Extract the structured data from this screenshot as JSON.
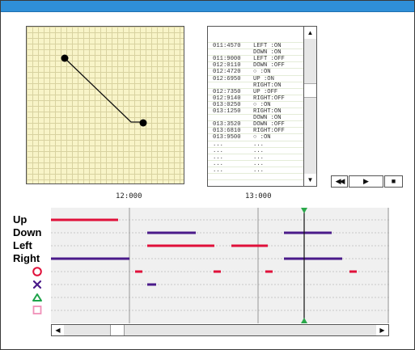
{
  "log": {
    "rows": [
      {
        "time": "",
        "event": ""
      },
      {
        "time": "011:4570",
        "event": "LEFT :ON"
      },
      {
        "time": "",
        "event": "DOWN :ON"
      },
      {
        "time": "011:9000",
        "event": "LEFT :OFF"
      },
      {
        "time": "012:0110",
        "event": "DOWN :OFF"
      },
      {
        "time": "012:4720",
        "event": "○ :ON"
      },
      {
        "time": "012:6950",
        "event": "UP :ON"
      },
      {
        "time": "",
        "event": "RIGHT:ON"
      },
      {
        "time": "012:7350",
        "event": "UP :OFF"
      },
      {
        "time": "012:9140",
        "event": "RIGHT:OFF"
      },
      {
        "time": "013:0250",
        "event": "○ :ON"
      },
      {
        "time": "013:1250",
        "event": "RIGHT:ON"
      },
      {
        "time": "",
        "event": "DOWN :ON"
      },
      {
        "time": "013:3520",
        "event": "DOWN :OFF"
      },
      {
        "time": "013:6810",
        "event": "RIGHT:OFF"
      },
      {
        "time": "013:9500",
        "event": "○ :ON"
      },
      {
        "time": "...",
        "event": "..."
      },
      {
        "time": "...",
        "event": "..."
      },
      {
        "time": "...",
        "event": "..."
      },
      {
        "time": "...",
        "event": "..."
      },
      {
        "time": "...",
        "event": "..."
      },
      {
        "time": "",
        "event": ""
      },
      {
        "time": "",
        "event": ""
      }
    ]
  },
  "scroll": {
    "up": "▲",
    "down": "▼",
    "left": "◀",
    "right": "▶"
  },
  "player": {
    "rewind": "◀◀",
    "play": "▶",
    "stop": "■"
  },
  "timeline": {
    "time_labels": [
      "12:000",
      "13:000"
    ],
    "channels": [
      {
        "label": "Up",
        "icon": ""
      },
      {
        "label": "Down",
        "icon": ""
      },
      {
        "label": "Left",
        "icon": ""
      },
      {
        "label": "Right",
        "icon": ""
      },
      {
        "label": "",
        "icon": "circle-icon"
      },
      {
        "label": "",
        "icon": "cross-icon"
      },
      {
        "label": "",
        "icon": "triangle-icon"
      },
      {
        "label": "",
        "icon": "square-icon"
      }
    ],
    "colors": {
      "red": "#e0103a",
      "purple": "#4a1a8a",
      "marker": "#2aa84a"
    }
  }
}
